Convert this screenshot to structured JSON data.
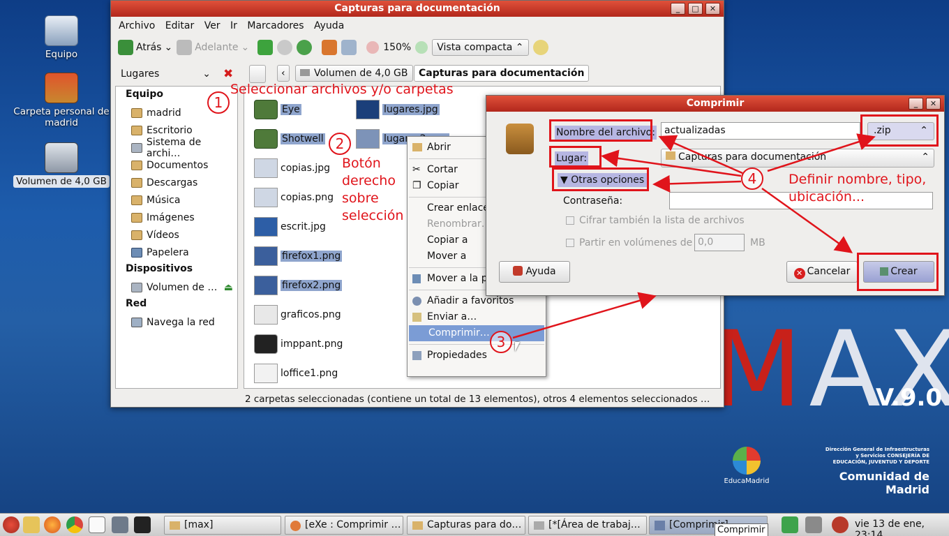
{
  "desktop": {
    "icons": [
      {
        "label": "Equipo"
      },
      {
        "label": "Carpeta personal de madrid"
      },
      {
        "label": "Volumen de 4,0 GB"
      }
    ],
    "wallpaper_brand": "MAX",
    "wallpaper_version": "V.9.0",
    "educamadrid": "EducaMadrid",
    "consejeria": "Dirección General de Infraestructuras y Servicios CONSEJERÍA DE EDUCACIÓN, JUVENTUD Y DEPORTE",
    "comunidad": "Comunidad de Madrid"
  },
  "file_manager": {
    "title": "Capturas para documentación",
    "menu": [
      "Archivo",
      "Editar",
      "Ver",
      "Ir",
      "Marcadores",
      "Ayuda"
    ],
    "toolbar": {
      "back": "Atrás",
      "forward": "Adelante",
      "zoom": "150%",
      "view": "Vista compacta"
    },
    "places_label": "Lugares",
    "path": [
      "Volumen de 4,0 GB",
      "Capturas para documentación"
    ],
    "sidebar": {
      "equipo_header": "Equipo",
      "equipo": [
        "madrid",
        "Escritorio",
        "Sistema de archi…",
        "Documentos",
        "Descargas",
        "Música",
        "Imágenes",
        "Vídeos",
        "Papelera"
      ],
      "devices_header": "Dispositivos",
      "devices": [
        "Volumen de …"
      ],
      "network_header": "Red",
      "network": [
        "Navega la red"
      ]
    },
    "files_col1": [
      "Eye",
      "Shotwell",
      "copias.jpg",
      "copias.png",
      "escrit.jpg",
      "firefox1.png",
      "firefox2.png",
      "graficos.png",
      "imppant.png",
      "loffice1.png"
    ],
    "files_col2": [
      "lugares.jpg",
      "lugares2.png"
    ],
    "status": "2 carpetas seleccionadas (contiene un total de 13 elementos), otros 4 elementos seleccionados …"
  },
  "context_menu": {
    "items": [
      "Abrir",
      "Cortar",
      "Copiar",
      "Crear enlace",
      "Renombrar…",
      "Copiar a",
      "Mover a",
      "Mover a la pa",
      "Añadir a favoritos",
      "Enviar a…",
      "Comprimir…",
      "Propiedades"
    ]
  },
  "dialog": {
    "title": "Comprimir",
    "filename_label": "Nombre del archivo:",
    "filename_value": "actualizadas",
    "extension": ".zip",
    "location_label": "Lugar:",
    "location_value": "Capturas para documentación",
    "more_options": "▼ Otras opciones",
    "password_label": "Contraseña:",
    "encrypt_label": "Cifrar también la lista de archivos",
    "split_label": "Partir en volúmenes de",
    "split_value": "0,0",
    "split_unit": "MB",
    "help": "Ayuda",
    "cancel": "Cancelar",
    "create": "Crear"
  },
  "annotations": {
    "n1": "1",
    "n2": "2",
    "n3": "3",
    "n4": "4",
    "step1": "Seleccionar archivos y/o carpetas",
    "step2_l1": "Botón",
    "step2_l2": "derecho",
    "step2_l3": "sobre",
    "step2_l4": "selección",
    "step4_l1": "Definir nombre, tipo,",
    "step4_l2": "ubicación..."
  },
  "taskbar": {
    "tasks": [
      "[max]",
      "[eXe : Comprimir …",
      "Capturas para do…",
      "[*[Área de trabaj…",
      "[Comprimir]"
    ],
    "tooltip": "Comprimir",
    "clock": "vie 13 de ene, 23:14"
  },
  "colors": {
    "annotation": "#e0141b",
    "titlebar": "#c5372a",
    "selection": "#8fa5cd"
  }
}
